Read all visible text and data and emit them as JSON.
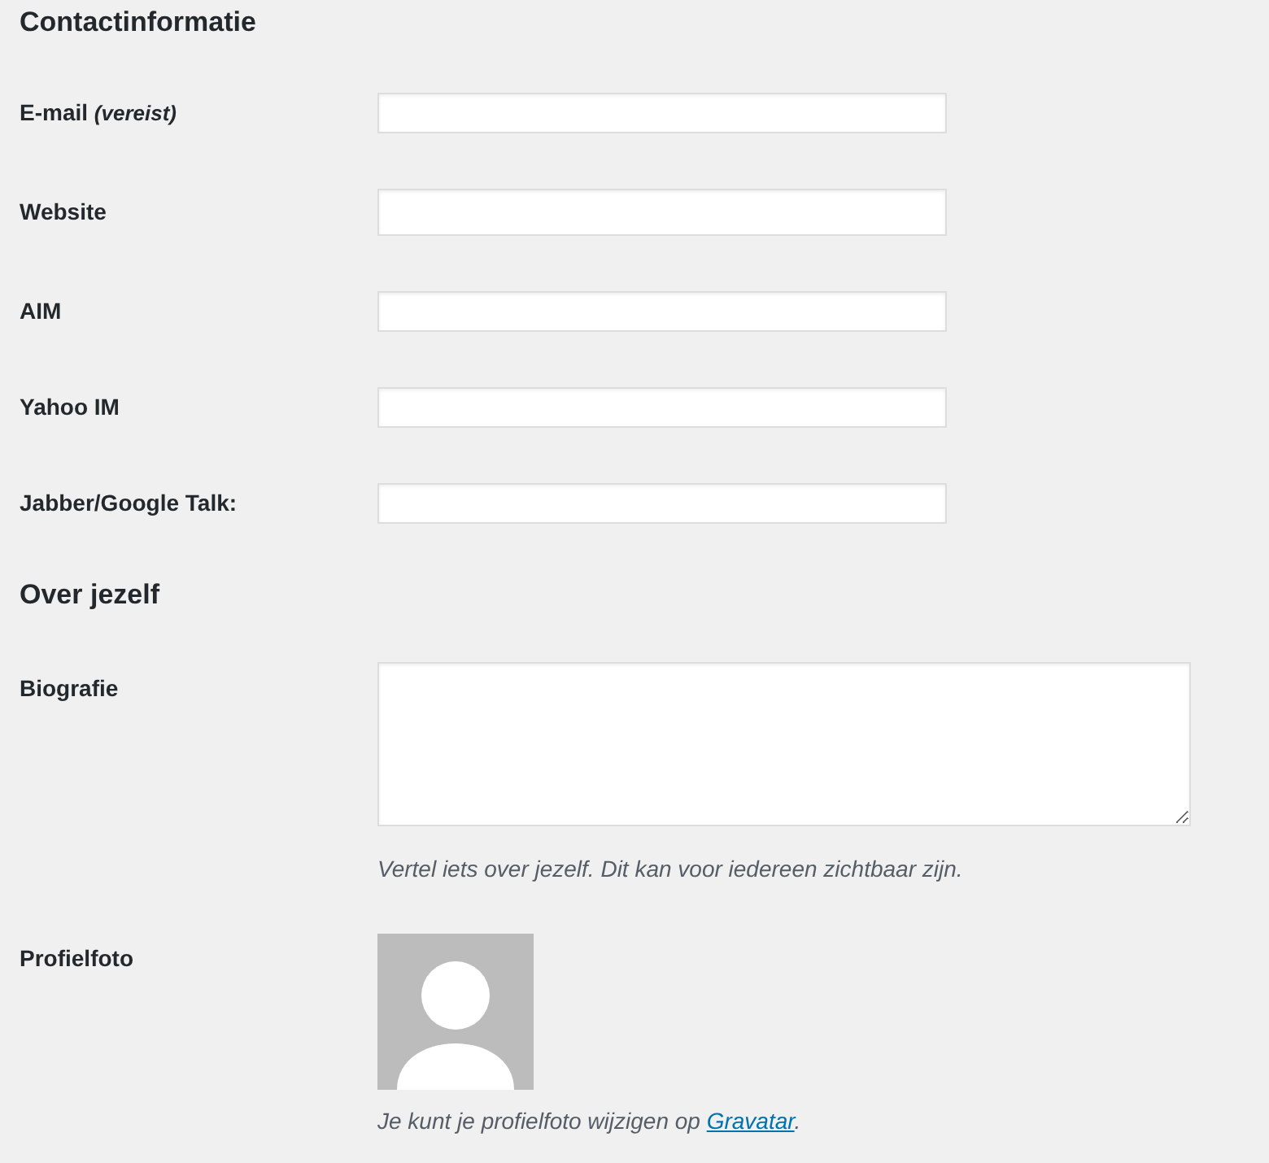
{
  "sections": [
    {
      "title": "Contactinformatie",
      "fields": [
        {
          "kind": "text",
          "label": "E-mail *(vereist)*"
        },
        {
          "kind": "url",
          "label": "Website"
        },
        {
          "kind": "text",
          "label": "AIM"
        },
        {
          "kind": "text",
          "label": "Yahoo IM"
        },
        {
          "kind": "text",
          "label": "Jabber/Google Talk:"
        }
      ]
    },
    {
      "title": "Over jezelf",
      "fields": [
        {
          "kind": "textarea",
          "label": "Biografie",
          "description": "Vertel iets over jezelf. Dit kan voor iedereen zichtbaar zijn."
        },
        {
          "kind": "avatar",
          "label": "Profielfoto",
          "description": "Je kunt je profielfoto wijzigen op ",
          "link": "Gravatar",
          "description_end": "."
        }
      ]
    }
  ]
}
